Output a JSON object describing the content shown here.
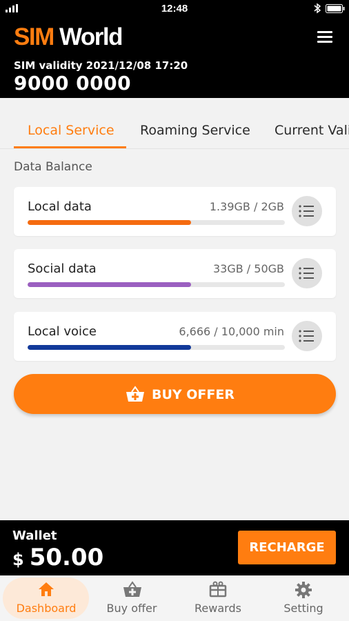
{
  "status_bar": {
    "time": "12:48"
  },
  "header": {
    "brand_sim": "SIM",
    "brand_world": "World",
    "validity": "SIM validity 2021/12/08 17:20",
    "phone_number": "9000 0000"
  },
  "tabs": [
    {
      "label": "Local Service",
      "active": true
    },
    {
      "label": "Roaming Service",
      "active": false
    },
    {
      "label": "Current Validity",
      "active": false
    }
  ],
  "data_balance": {
    "title": "Data Balance",
    "items": [
      {
        "label": "Local data",
        "value": "1.39GB / 2GB",
        "progress": 0.635,
        "color": "#f56b10"
      },
      {
        "label": "Social data",
        "value": "33GB / 50GB",
        "progress": 0.635,
        "color": "#9b5fc0"
      },
      {
        "label": "Local voice",
        "value": "6,666 / 10,000 min",
        "progress": 0.635,
        "color": "#12399a"
      }
    ]
  },
  "buy_offer_button": {
    "label": "BUY OFFER",
    "icon": "basket-plus-icon"
  },
  "wallet": {
    "label": "Wallet",
    "currency": "$",
    "amount": "50.00",
    "recharge_label": "RECHARGE"
  },
  "bottom_nav": [
    {
      "label": "Dashboard",
      "icon": "home-icon",
      "active": true
    },
    {
      "label": "Buy offer",
      "icon": "basket-plus-icon",
      "active": false
    },
    {
      "label": "Rewards",
      "icon": "gift-icon",
      "active": false
    },
    {
      "label": "Setting",
      "icon": "gear-icon",
      "active": false
    }
  ],
  "colors": {
    "accent": "#ff7d10",
    "header_bg": "#000000",
    "page_bg": "#f2f2f2"
  }
}
